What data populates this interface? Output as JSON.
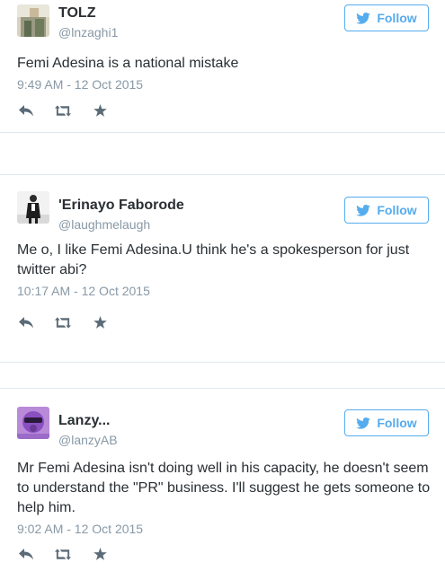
{
  "colors": {
    "accent": "#55acee",
    "text": "#292f33",
    "muted": "#8899a6",
    "icon": "#5a6b77",
    "divider": "#e1e8ed"
  },
  "tweets": [
    {
      "name": "TOLZ",
      "handle": "@lnzaghi1",
      "follow_label": "Follow",
      "text": "Femi Adesina is a national mistake",
      "timestamp": "9:49 AM - 12 Oct 2015",
      "avatar_icon": "avatar-photo",
      "actions": [
        "reply-icon",
        "retweet-icon",
        "favorite-icon"
      ]
    },
    {
      "name": "'Erinayo Faborode",
      "handle": "@laughmelaugh",
      "follow_label": "Follow",
      "text": "Me o, I like Femi Adesina.U think he's a spokesperson for just twitter abi?",
      "timestamp": "10:17 AM - 12 Oct 2015",
      "avatar_icon": "avatar-photo",
      "actions": [
        "reply-icon",
        "retweet-icon",
        "favorite-icon"
      ]
    },
    {
      "name": "Lanzy...",
      "handle": "@lanzyAB",
      "follow_label": "Follow",
      "text": "Mr Femi Adesina isn't doing well in his capacity, he doesn't seem to understand the \"PR\" business. I'll suggest he gets someone to help him.",
      "timestamp": "9:02 AM - 12 Oct 2015",
      "avatar_icon": "avatar-photo",
      "actions": [
        "reply-icon",
        "retweet-icon",
        "favorite-icon"
      ]
    }
  ]
}
